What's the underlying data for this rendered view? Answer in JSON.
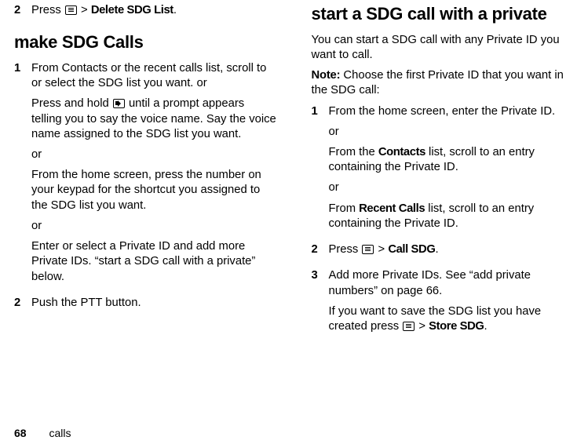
{
  "left": {
    "step1_num": "2",
    "step1_a": "Press ",
    "step1_b": " > ",
    "step1_bold": "Delete SDG List",
    "step1_c": ".",
    "heading": "make SDG Calls",
    "s2_num": "1",
    "s2_p1": "From Contacts or the recent calls list, scroll to or select the SDG list you want. or",
    "s2_p2a": "Press and hold ",
    "s2_p2b": " until a prompt appears telling you to say the voice name. Say the voice name assigned to the SDG list you want.",
    "s2_or2": "or",
    "s2_p3": "From the home screen, press the number on your keypad for the shortcut you assigned to the SDG list you want.",
    "s2_or3": "or",
    "s2_p4": "Enter or select a Private ID and add more Private IDs. “start a SDG call with a private” below.",
    "s3_num": "2",
    "s3_p": "Push the PTT button."
  },
  "right": {
    "heading": "start a SDG call with a private",
    "intro": "You can start a SDG call with any Private ID you want to call.",
    "note_label": "Note:",
    "note_text": " Choose the first Private ID that you want in the SDG call:",
    "r1_num": "1",
    "r1_p1": "From the home screen, enter the Private ID.",
    "r1_or1": "or",
    "r1_p2a": "From the ",
    "r1_p2bold": "Contacts",
    "r1_p2b": " list, scroll to an entry containing the Private ID.",
    "r1_or2": "or",
    "r1_p3a": "From ",
    "r1_p3bold": "Recent Calls",
    "r1_p3b": " list, scroll to an entry containing the Private ID.",
    "r2_num": "2",
    "r2_a": "Press ",
    "r2_b": " > ",
    "r2_bold": "Call SDG",
    "r2_c": ".",
    "r3_num": "3",
    "r3_p1": "Add more Private IDs. See “add private numbers” on page 66.",
    "r3_p2a": "If you want to save the SDG list you have created press ",
    "r3_p2b": " > ",
    "r3_p2bold": "Store SDG",
    "r3_p2c": "."
  },
  "footer": {
    "page": "68",
    "section": "calls"
  }
}
